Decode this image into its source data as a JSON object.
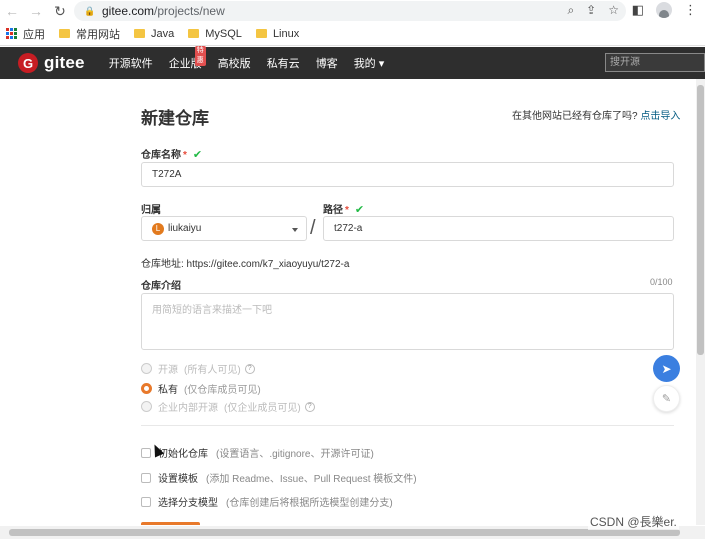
{
  "browser": {
    "url_host": "gitee.com",
    "url_path": "/projects/new",
    "bookmarks": [
      {
        "label": "应用",
        "icon": "apps-grid-icon"
      },
      {
        "label": "常用网站",
        "icon": "folder-icon"
      },
      {
        "label": "Java",
        "icon": "folder-icon"
      },
      {
        "label": "MySQL",
        "icon": "folder-icon"
      },
      {
        "label": "Linux",
        "icon": "folder-icon"
      }
    ]
  },
  "header": {
    "logo_letter": "G",
    "logo_text": "gitee",
    "nav": [
      {
        "label": "开源软件"
      },
      {
        "label": "企业版",
        "badge": "特惠"
      },
      {
        "label": "高校版"
      },
      {
        "label": "私有云"
      },
      {
        "label": "博客"
      },
      {
        "label": "我的 ▾"
      }
    ],
    "search_placeholder": "搜开源"
  },
  "form": {
    "title": "新建仓库",
    "import_text": "在其他网站已经有仓库了吗?",
    "import_link": "点击导入",
    "repo_name_label": "仓库名称",
    "repo_name_value": "T272A",
    "owner_label": "归属",
    "owner_initial": "L",
    "owner_value": "liukaiyu",
    "path_label": "路径",
    "path_value": "t272-a",
    "slash": "/",
    "repo_address": "仓库地址: https://gitee.com/k7_xiaoyuyu/t272-a",
    "desc_label": "仓库介绍",
    "desc_counter": "0/100",
    "desc_placeholder": "用简短的语言来描述一下吧",
    "visibility": [
      {
        "label": "开源",
        "note": "(所有人可见)",
        "help": true,
        "selected": false
      },
      {
        "label": "私有",
        "note": "(仅仓库成员可见)",
        "help": false,
        "selected": true
      },
      {
        "label": "企业内部开源",
        "note": "(仅企业成员可见)",
        "help": true,
        "selected": false
      }
    ],
    "options": [
      {
        "label": "初始化仓库",
        "note": "(设置语言、.gitignore、开源许可证)"
      },
      {
        "label": "设置模板",
        "note": "(添加 Readme、Issue、Pull Request 模板文件)"
      },
      {
        "label": "选择分支模型",
        "note": "(仓库创建后将根据所选模型创建分支)"
      }
    ]
  },
  "watermark": "CSDN @長樂er.",
  "colors": {
    "accent": "#e8792b",
    "header_bg": "#2e2e2e",
    "brand": "#c71d23",
    "link": "#005980",
    "check": "#21ba45"
  }
}
